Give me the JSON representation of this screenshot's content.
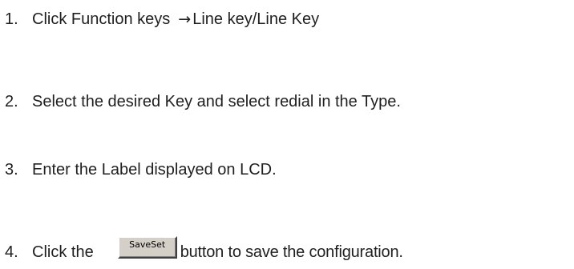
{
  "steps": [
    {
      "number": "1.",
      "text_before_arrow": "Click Function keys",
      "arrow": "→",
      "text_after_arrow": "Line key/Line Key"
    },
    {
      "number": "2.",
      "text": "Select the desired Key and select redial in the Type."
    },
    {
      "number": "3.",
      "text": "Enter the Label displayed on LCD."
    },
    {
      "number": "4.",
      "text_before_button": "Click the",
      "button_label": "SaveSet",
      "text_after_button": "button to save the configuration."
    }
  ]
}
